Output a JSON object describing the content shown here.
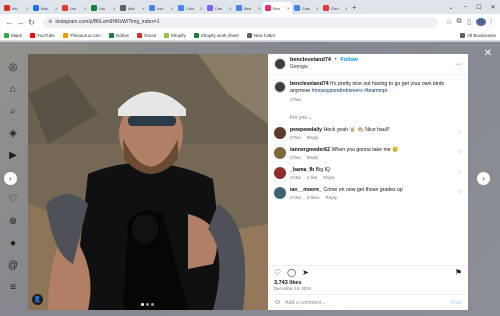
{
  "browser": {
    "tabs": [
      {
        "label": "Inb",
        "color": "#d93025"
      },
      {
        "label": "Bris",
        "color": "#1a73e8"
      },
      {
        "label": "Uni",
        "color": "#e53935"
      },
      {
        "label": "Uni",
        "color": "#188038"
      },
      {
        "label": "Mai",
        "color": "#5f6368"
      },
      {
        "label": "usn",
        "color": "#4285f4"
      },
      {
        "label": "Colo",
        "color": "#4285f4"
      },
      {
        "label": "Can",
        "color": "#7b61ff"
      },
      {
        "label": "Ben",
        "color": "#4285f4"
      },
      {
        "label": "Ben",
        "color": "#e1306c",
        "active": true
      },
      {
        "label": "Clas",
        "color": "#4285f4"
      },
      {
        "label": "Geo",
        "color": "#e53935"
      }
    ],
    "new_tab": "+",
    "url": "instagram.com/p/B6Lom9HRzW/?img_index=1"
  },
  "bookmarks": {
    "items": [
      {
        "label": "Maps",
        "color": "#34a853"
      },
      {
        "label": "YouTube",
        "color": "#ff0000"
      },
      {
        "label": "Thesaurus.com",
        "color": "#f29900"
      },
      {
        "label": "Gdrive",
        "color": "#188038"
      },
      {
        "label": "Gmail",
        "color": "#d93025"
      },
      {
        "label": "Shopify",
        "color": "#95bf47"
      },
      {
        "label": "Shopify work sheet",
        "color": "#188038"
      },
      {
        "label": "New folder",
        "color": "#5f6368"
      }
    ],
    "all_bookmarks": "All Bookmarks"
  },
  "post": {
    "username": "bencleveland74",
    "follow": "Follow",
    "location": "Georgia",
    "caption_user": "bencleveland74",
    "caption_text": "It's pretty nice not having to go get your own birds anymore",
    "caption_tags": "#mossypondretrievers #teammpr",
    "caption_time": "275w",
    "for_you": "For you",
    "comments": [
      {
        "user": "pewpewdaily",
        "text": "Heck yeah 🤘🏼 👏🏼 Nice haul!!",
        "time": "275w",
        "reply": "Reply",
        "likes": "",
        "color": "#5b3a2a"
      },
      {
        "user": "tannergowder62",
        "text": "When you gonna take me 😢",
        "time": "275w",
        "reply": "Reply",
        "likes": "",
        "color": "#7a6a3d"
      },
      {
        "user": "_bama_fb",
        "text": "Big IQ",
        "time": "274w",
        "reply": "Reply",
        "likes": "1 like",
        "color": "#8d2d2d"
      },
      {
        "user": "ian__moore_",
        "text": "Come on now get those grades up",
        "time": "274w",
        "reply": "Reply",
        "likes": "3 likes",
        "color": "#3d6470"
      }
    ],
    "likes": "3,743 likes",
    "date": "December 18, 2019",
    "comment_placeholder": "Add a comment...",
    "post_label": "Post"
  }
}
